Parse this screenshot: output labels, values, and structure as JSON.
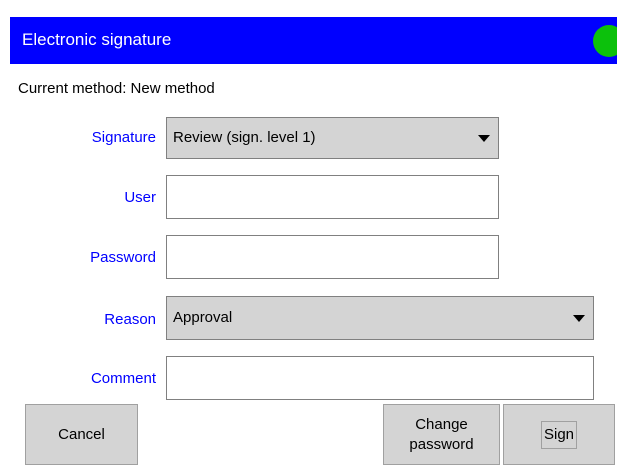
{
  "window": {
    "title": "Electronic signature",
    "status_color": "#0cc10c",
    "status_icon": "status-indicator-icon"
  },
  "current_method": "Current method: New method",
  "form": {
    "signature": {
      "label": "Signature",
      "value": "Review (sign. level 1)"
    },
    "user": {
      "label": "User",
      "value": ""
    },
    "password": {
      "label": "Password",
      "value": ""
    },
    "reason": {
      "label": "Reason",
      "value": "Approval"
    },
    "comment": {
      "label": "Comment",
      "value": ""
    }
  },
  "buttons": {
    "cancel": "Cancel",
    "change_password_line1": "Change",
    "change_password_line2": "password",
    "sign": "Sign"
  },
  "colors": {
    "title_bar": "#0000ff",
    "label": "#0000ff",
    "control_bg": "#d4d4d4"
  }
}
